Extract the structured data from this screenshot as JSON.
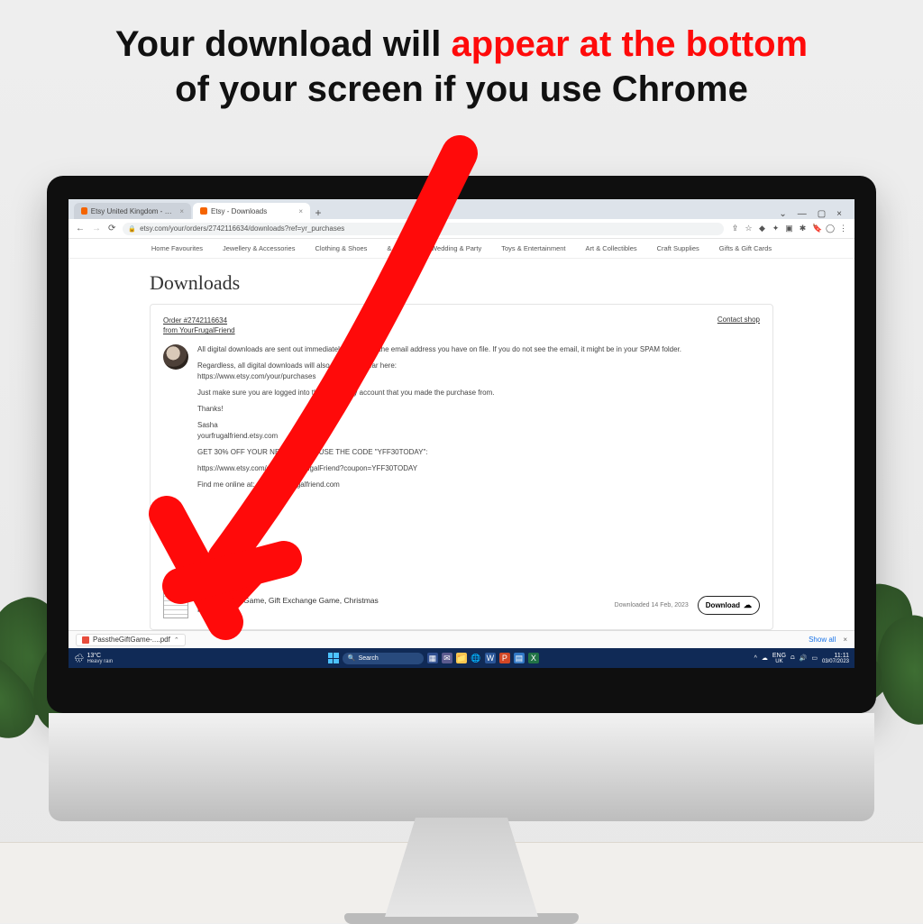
{
  "headline": {
    "part1": "Your download will ",
    "part2_red": "appear at the bottom",
    "part3": " of your screen if you use Chrome"
  },
  "tabs": {
    "tab1": "Etsy United Kingdom - Shop for",
    "tab2": "Etsy - Downloads"
  },
  "address": {
    "url": "etsy.com/your/orders/2742116634/downloads?ref=yr_purchases"
  },
  "categories": [
    "Home Favourites",
    "Jewellery & Accessories",
    "Clothing & Shoes",
    "& Living",
    "Wedding & Party",
    "Toys & Entertainment",
    "Art & Collectibles",
    "Craft Supplies",
    "Gifts & Gift Cards"
  ],
  "page": {
    "title": "Downloads",
    "order_link": "Order #2742116634",
    "shop_link": "from YourFrugalFriend",
    "contact": "Contact shop",
    "msg": {
      "p1": "All digital downloads are sent out immediately by Etsy to the email address you have on file. If you do not see the email, it might be in your SPAM folder.",
      "p2": "Regardless, all digital downloads will also always appear here:",
      "p2link": "https://www.etsy.com/your/purchases",
      "p3": "Just make sure you are logged into the same Etsy account that you made the purchase from.",
      "p4": "Thanks!",
      "p5": "Sasha",
      "p5b": "yourfrugalfriend.etsy.com",
      "p6": "GET 30% OFF YOUR NEXT ORDER USE THE CODE \"YFF30TODAY\":",
      "p7": "https://www.etsy.com/shop/YourFrugalFriend?coupon=YFF30TODAY",
      "p8": "Find me online at: www.yourfrugalfriend.com"
    },
    "file": {
      "name": "Pass the Gift Game, Gift Exchange Game, Christmas Party Game",
      "date": "Downloaded 14 Feb, 2023",
      "btn": "Download"
    }
  },
  "shelf": {
    "file": "PasstheGiftGame-....pdf",
    "showall": "Show all"
  },
  "taskbar": {
    "temp": "13°C",
    "cond": "Heavy rain",
    "search": "Search",
    "lang": "ENG",
    "region": "UK",
    "time": "11:11",
    "date": "03/07/2023"
  }
}
